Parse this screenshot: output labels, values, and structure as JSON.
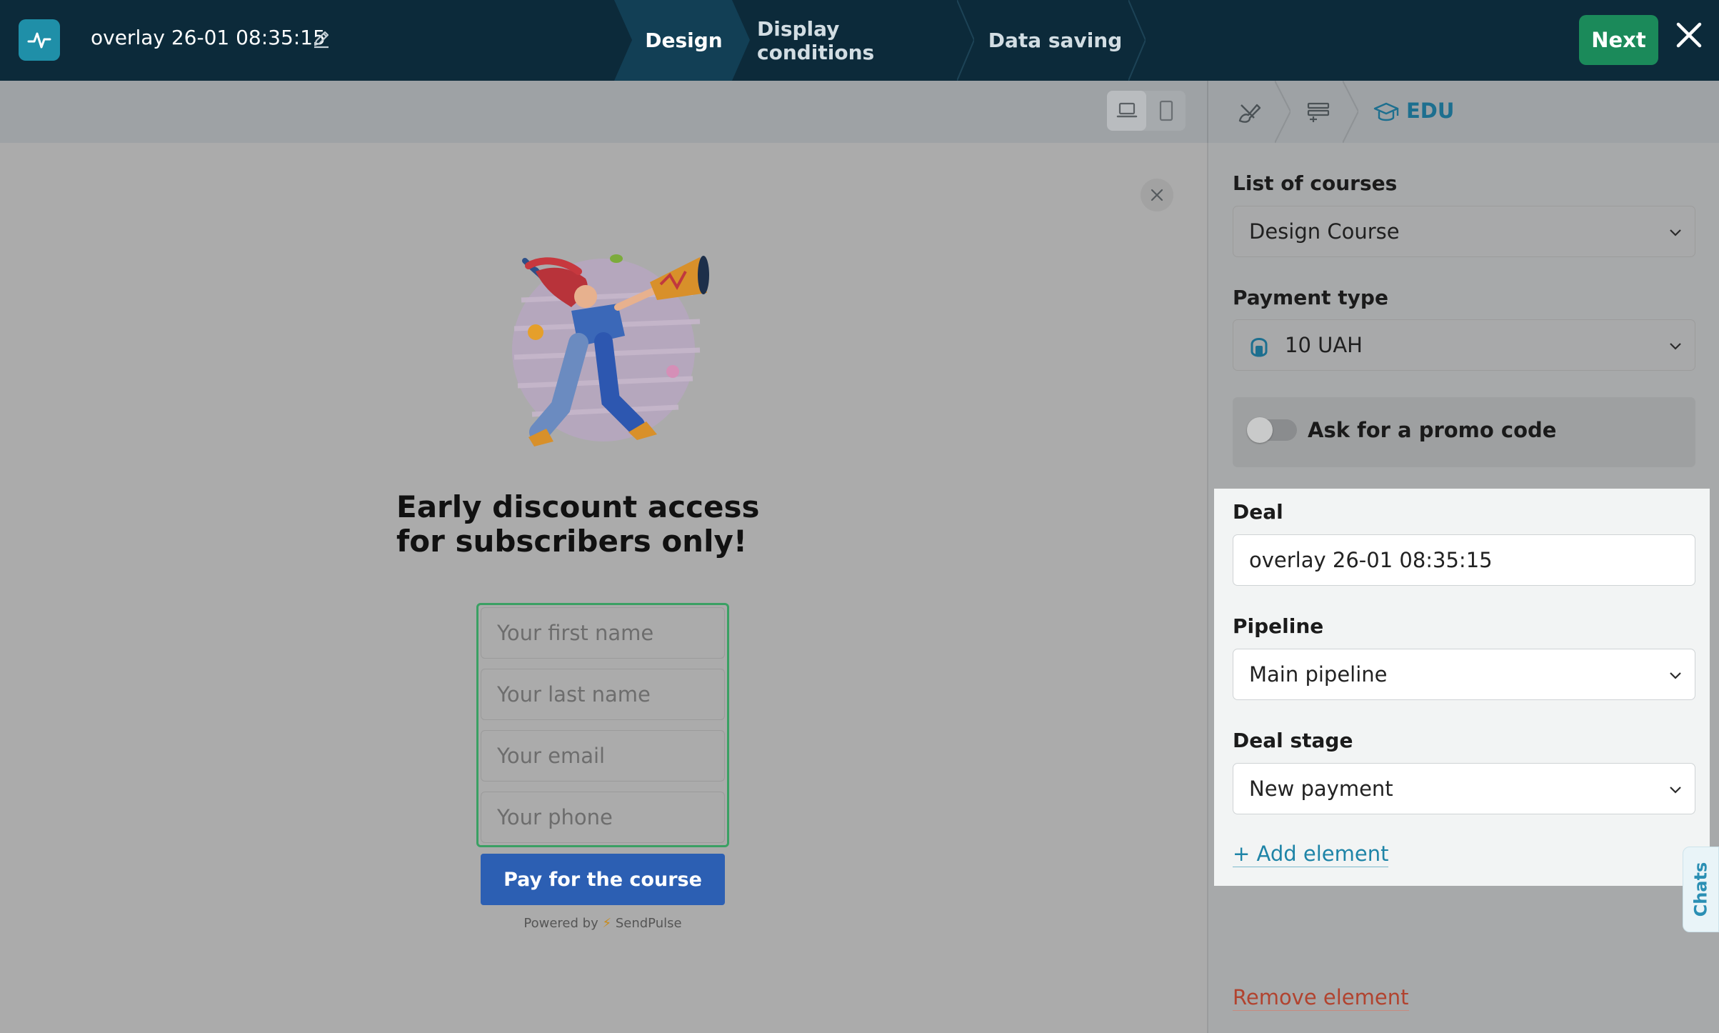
{
  "topbar": {
    "title": "overlay 26-01 08:35:15",
    "steps": [
      "Design",
      "Display conditions",
      "Data saving"
    ],
    "next_label": "Next",
    "icons": [
      "pulse-logo-icon",
      "pencil-icon",
      "close-icon"
    ]
  },
  "canvas": {
    "headline": "Early discount access for subscribers only!",
    "form": {
      "first_name_placeholder": "Your first name",
      "last_name_placeholder": "Your last name",
      "email_placeholder": "Your email",
      "phone_placeholder": "Your phone",
      "submit_label": "Pay for the course"
    },
    "powered_prefix": "Powered by",
    "powered_brand": "SendPulse",
    "device_icons": [
      "desktop-icon",
      "mobile-icon"
    ]
  },
  "panel": {
    "breadcrumb_label": "EDU",
    "courses_label": "List of courses",
    "courses_value": "Design Course",
    "payment_label": "Payment type",
    "payment_value": "10 UAH",
    "promo_label": "Ask for a promo code",
    "promo_enabled": false,
    "deal_label": "Deal",
    "deal_value": "overlay 26-01 08:35:15",
    "pipeline_label": "Pipeline",
    "pipeline_value": "Main pipeline",
    "stage_label": "Deal stage",
    "stage_value": "New payment",
    "add_element": "+ Add element",
    "remove_element": "Remove element",
    "chats_tab": "Chats"
  },
  "colors": {
    "topbar_bg": "#0c2a3a",
    "next_btn": "#1b8a5a",
    "pay_btn": "#2c5fb3",
    "form_border": "#3aa063",
    "link_blue": "#1e84a7",
    "remove_red": "#b1432f"
  }
}
